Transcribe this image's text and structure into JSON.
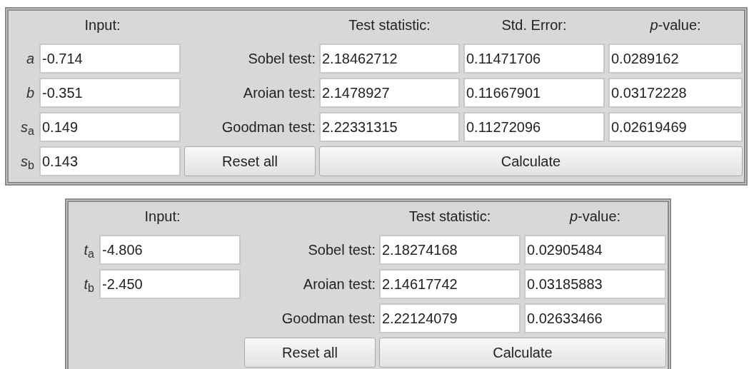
{
  "calculators": [
    {
      "input_heading": "Input:",
      "column_headings": [
        "Test statistic:",
        "Std. Error:",
        "*p*-value:"
      ],
      "inputs": [
        {
          "label": "a",
          "value": "-0.714"
        },
        {
          "label": "b",
          "value": "-0.351"
        },
        {
          "label": "s$_{a}$",
          "value": "0.149"
        },
        {
          "label": "s$_{b}$",
          "value": "0.143"
        }
      ],
      "tests": [
        {
          "label": "Sobel test:",
          "values": [
            "2.18462712",
            "0.11471706",
            "0.0289162"
          ]
        },
        {
          "label": "Aroian test:",
          "values": [
            "2.1478927",
            "0.11667901",
            "0.03172228"
          ]
        },
        {
          "label": "Goodman test:",
          "values": [
            "2.22331315",
            "0.11272096",
            "0.02619469"
          ]
        }
      ],
      "buttons": [
        "Reset all",
        "Calculate"
      ]
    },
    {
      "input_heading": "Input:",
      "column_headings": [
        "Test statistic:",
        "*p*-value:"
      ],
      "inputs": [
        {
          "label": "t$_{a}$",
          "value": "-4.806"
        },
        {
          "label": "t$_{b}$",
          "value": "-2.450"
        }
      ],
      "tests": [
        {
          "label": "Sobel test:",
          "values": [
            "2.18274168",
            "0.02905484"
          ]
        },
        {
          "label": "Aroian test:",
          "values": [
            "2.14617742",
            "0.03185883"
          ]
        },
        {
          "label": "Goodman test:",
          "values": [
            "2.22124079",
            "0.02633466"
          ]
        }
      ],
      "buttons": [
        "Reset all",
        "Calculate"
      ]
    }
  ]
}
